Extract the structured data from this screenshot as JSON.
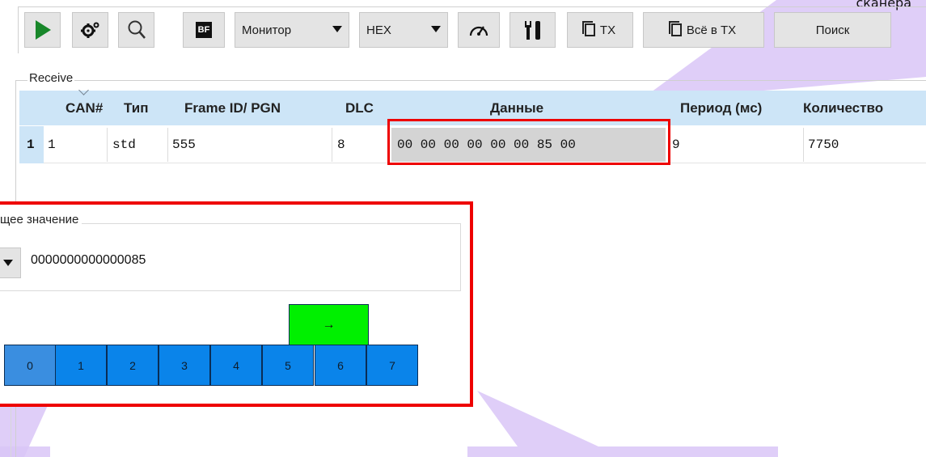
{
  "corner_label": "сканера",
  "toolbar": {
    "play_icon": "play-icon",
    "settings_icon": "gear-icon",
    "search_icon": "magnifier-icon",
    "bf_label": "BF",
    "mode_select": "Монитор",
    "format_select": "HEX",
    "speed_icon": "gauge-icon",
    "tools_icon": "tools-icon",
    "tx_label": "TX",
    "all_tx_label": "Всё в TX",
    "search_label": "Поиск"
  },
  "receive": {
    "group_label": "Receive",
    "columns": [
      "CAN#",
      "Тип",
      "Frame ID/ PGN",
      "DLC",
      "Данные",
      "Период (мс)",
      "Количество"
    ],
    "rows": [
      {
        "index": "1",
        "can": "1",
        "type": "std",
        "frame_id": "555",
        "dlc": "8",
        "data": "00 00 00 00 00 00 85 00",
        "period": "9",
        "count": "7750"
      }
    ]
  },
  "value_panel": {
    "group_label": "щее значение",
    "value": "0000000000000085",
    "arrow_label": "→",
    "bytes": [
      "0",
      "1",
      "2",
      "3",
      "4",
      "5",
      "6",
      "7"
    ]
  },
  "colors": {
    "accent_red": "#ee0000",
    "byte_blue": "#0a84ea",
    "selected_green": "#00f000",
    "header_blue": "#cde5f7",
    "highlight_purple": "#d9c6f7"
  }
}
